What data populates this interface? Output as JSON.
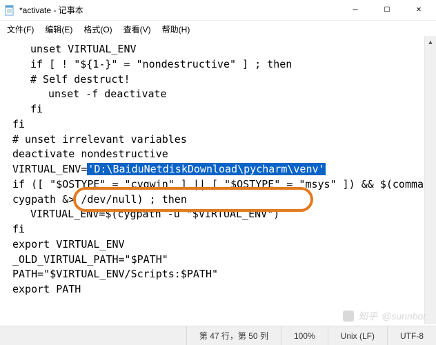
{
  "window": {
    "title": "*activate - 记事本"
  },
  "menu": {
    "file": "文件(F)",
    "edit": "编辑(E)",
    "format": "格式(O)",
    "view": "查看(V)",
    "help": "帮助(H)"
  },
  "code": {
    "l01": "unset VIRTUAL_ENV",
    "l02": "if [ ! \"${1-}\" = \"nondestructive\" ] ; then",
    "l03": "# Self destruct!",
    "l04": "unset -f deactivate",
    "l05": "fi",
    "l06": "fi",
    "l07": "",
    "l08": "# unset irrelevant variables",
    "l09": "deactivate nondestructive",
    "l10": "",
    "l11a": "VIRTUAL_ENV=",
    "l11sel": "'D:\\BaiduNetdiskDownload\\pycharm\\venv'",
    "l12": "if ([ \"$OSTYPE\" = \"cygwin\" ] || [ \"$OSTYPE\" = \"msys\" ]) && $(command -v",
    "l13": "cygpath &> /dev/null) ; then",
    "l14": "VIRTUAL_ENV=$(cygpath -u \"$VIRTUAL_ENV\")",
    "l15": "fi",
    "l16": "export VIRTUAL_ENV",
    "l17": "",
    "l18": "_OLD_VIRTUAL_PATH=\"$PATH\"",
    "l19": "PATH=\"$VIRTUAL_ENV/Scripts:$PATH\"",
    "l20": "export PATH"
  },
  "status": {
    "position": "第 47 行，第 50 列",
    "zoom": "100%",
    "lineend": "Unix (LF)",
    "encoding": "UTF-8"
  },
  "watermark": {
    "site": "知乎",
    "user": "@sunnbor"
  }
}
